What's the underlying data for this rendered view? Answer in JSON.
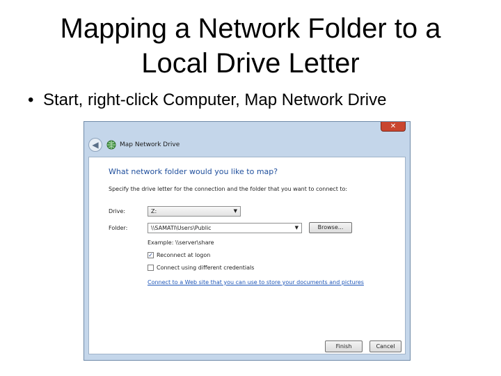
{
  "slide": {
    "title_line1": "Mapping a Network Folder to a",
    "title_line2": "Local Drive Letter",
    "bullet": "Start, right-click Computer, Map Network Drive"
  },
  "dialog": {
    "close_glyph": "✕",
    "window_title": "Map Network Drive",
    "heading": "What network folder would you like to map?",
    "description": "Specify the drive letter for the connection and the folder that you want to connect to:",
    "drive_label": "Drive:",
    "drive_value": "Z:",
    "folder_label": "Folder:",
    "folder_value": "\\\\SAMATI\\Users\\Public",
    "browse_label": "Browse...",
    "example": "Example: \\\\server\\share",
    "reconnect_label": "Reconnect at logon",
    "reconnect_checked": true,
    "credentials_label": "Connect using different credentials",
    "credentials_checked": false,
    "web_link": "Connect to a Web site that you can use to store your documents and pictures",
    "finish_label": "Finish",
    "cancel_label": "Cancel"
  }
}
